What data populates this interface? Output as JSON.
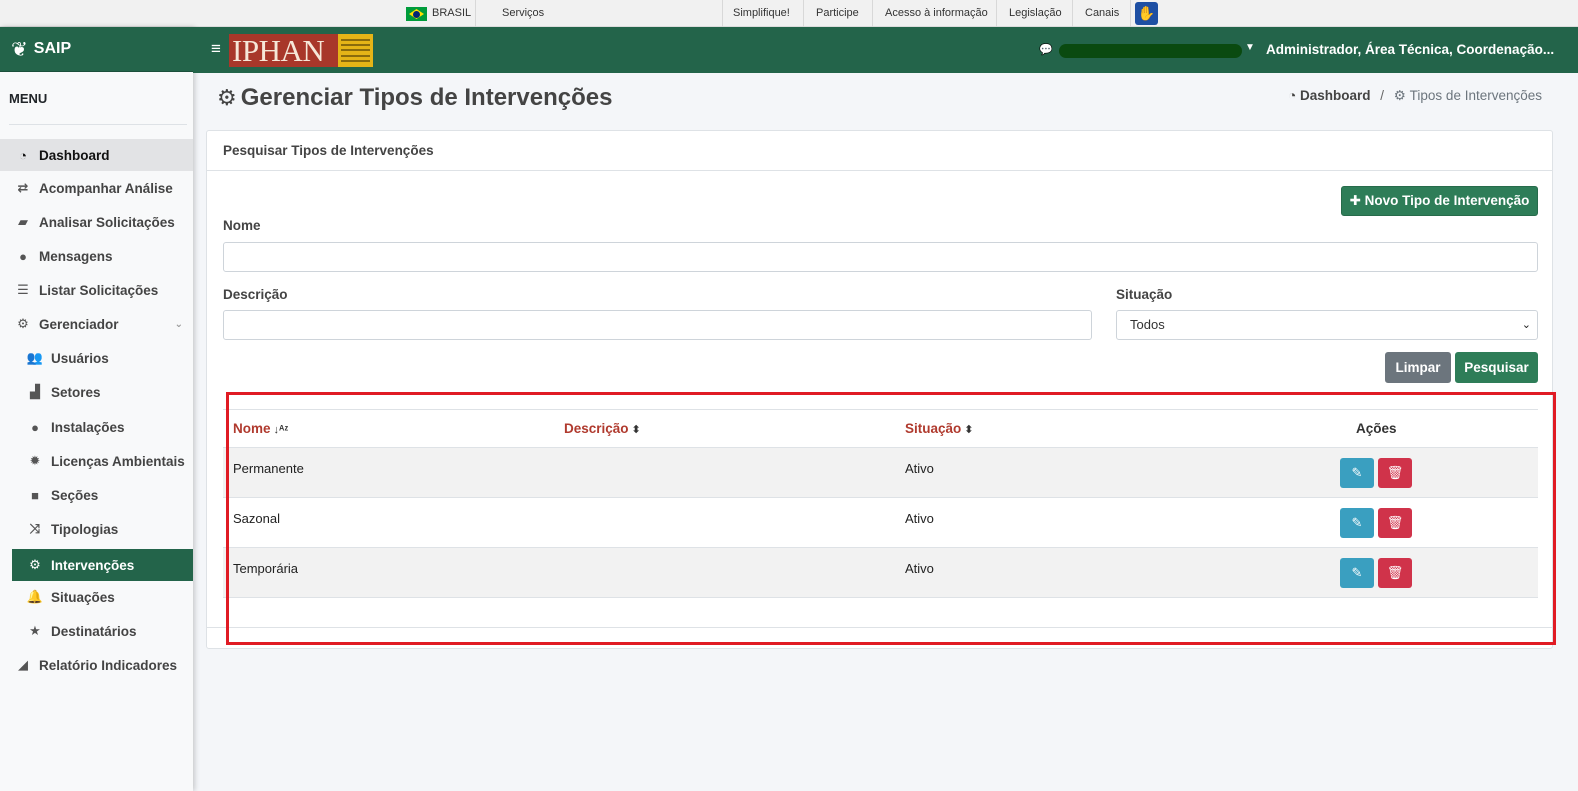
{
  "govbar": {
    "country": "BRASIL",
    "services": "Serviços",
    "links": [
      "Simplifique!",
      "Participe",
      "Acesso à informação",
      "Legislação",
      "Canais"
    ]
  },
  "sidebar": {
    "brand": "SAIP",
    "menu_title": "MENU",
    "items": [
      {
        "label": "Dashboard",
        "icon": "dashboard-icon"
      },
      {
        "label": "Acompanhar Análise",
        "icon": "exchange-icon"
      },
      {
        "label": "Analisar Solicitações",
        "icon": "book-icon"
      },
      {
        "label": "Mensagens",
        "icon": "comments-icon"
      },
      {
        "label": "Listar Solicitações",
        "icon": "list-icon"
      },
      {
        "label": "Gerenciador",
        "icon": "cogs-icon"
      },
      {
        "label": "Usuários",
        "icon": "users-icon"
      },
      {
        "label": "Setores",
        "icon": "industry-icon"
      },
      {
        "label": "Instalações",
        "icon": "circle-icon"
      },
      {
        "label": "Licenças Ambientais",
        "icon": "certificate-icon"
      },
      {
        "label": "Seções",
        "icon": "square-icon"
      },
      {
        "label": "Tipologias",
        "icon": "random-icon"
      },
      {
        "label": "Intervenções",
        "icon": "cog-icon"
      },
      {
        "label": "Situações",
        "icon": "bell-icon"
      },
      {
        "label": "Destinatários",
        "icon": "star-icon"
      },
      {
        "label": "Relatório Indicadores",
        "icon": "chart-area-icon"
      }
    ]
  },
  "header": {
    "logo_text": "IPHAN",
    "user": "Administrador, Área Técnica, Coordenação..."
  },
  "page": {
    "title": "Gerenciar Tipos de Intervenções",
    "breadcrumb": [
      "Dashboard",
      "Tipos de Intervenções"
    ]
  },
  "search": {
    "card_title": "Pesquisar Tipos de Intervenções",
    "new_button": "Novo Tipo de Intervenção",
    "name_label": "Nome",
    "name_value": "",
    "description_label": "Descrição",
    "description_value": "",
    "status_label": "Situação",
    "status_selected": "Todos",
    "clear_button": "Limpar",
    "search_button": "Pesquisar"
  },
  "table": {
    "columns": [
      "Nome",
      "Descrição",
      "Situação",
      "Ações"
    ],
    "rows": [
      {
        "name": "Permanente",
        "description": "",
        "status": "Ativo"
      },
      {
        "name": "Sazonal",
        "description": "",
        "status": "Ativo"
      },
      {
        "name": "Temporária",
        "description": "",
        "status": "Ativo"
      }
    ]
  },
  "colors": {
    "primary_green": "#23644a",
    "button_green": "#2e7d58",
    "edit_blue": "#3a9fc0",
    "delete_red": "#d0334a",
    "sort_header_red": "#b03a2e",
    "highlight_red": "#e01b24"
  }
}
